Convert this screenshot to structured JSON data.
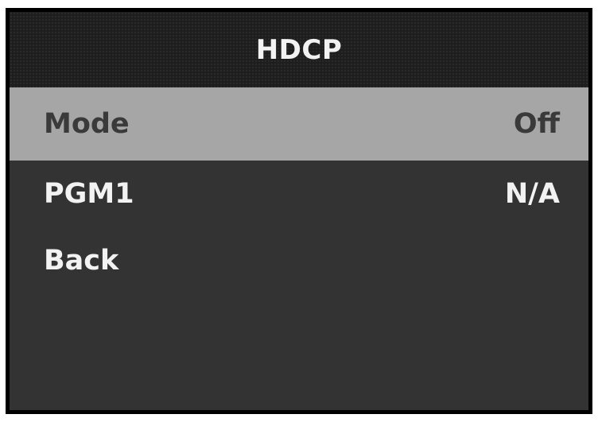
{
  "header": {
    "title": "HDCP"
  },
  "menu": {
    "items": [
      {
        "label": "Mode",
        "value": "Off",
        "selected": true
      },
      {
        "label": "PGM1",
        "value": "N/A",
        "selected": false
      },
      {
        "label": "Back",
        "value": "",
        "selected": false
      }
    ]
  },
  "colors": {
    "bezel": "#000000",
    "background": "#333333",
    "header_background": "#1e1e1e",
    "selection_highlight": "#a6a6a6",
    "text": "#f2f2f2",
    "selected_text": "#3a3a3a"
  }
}
